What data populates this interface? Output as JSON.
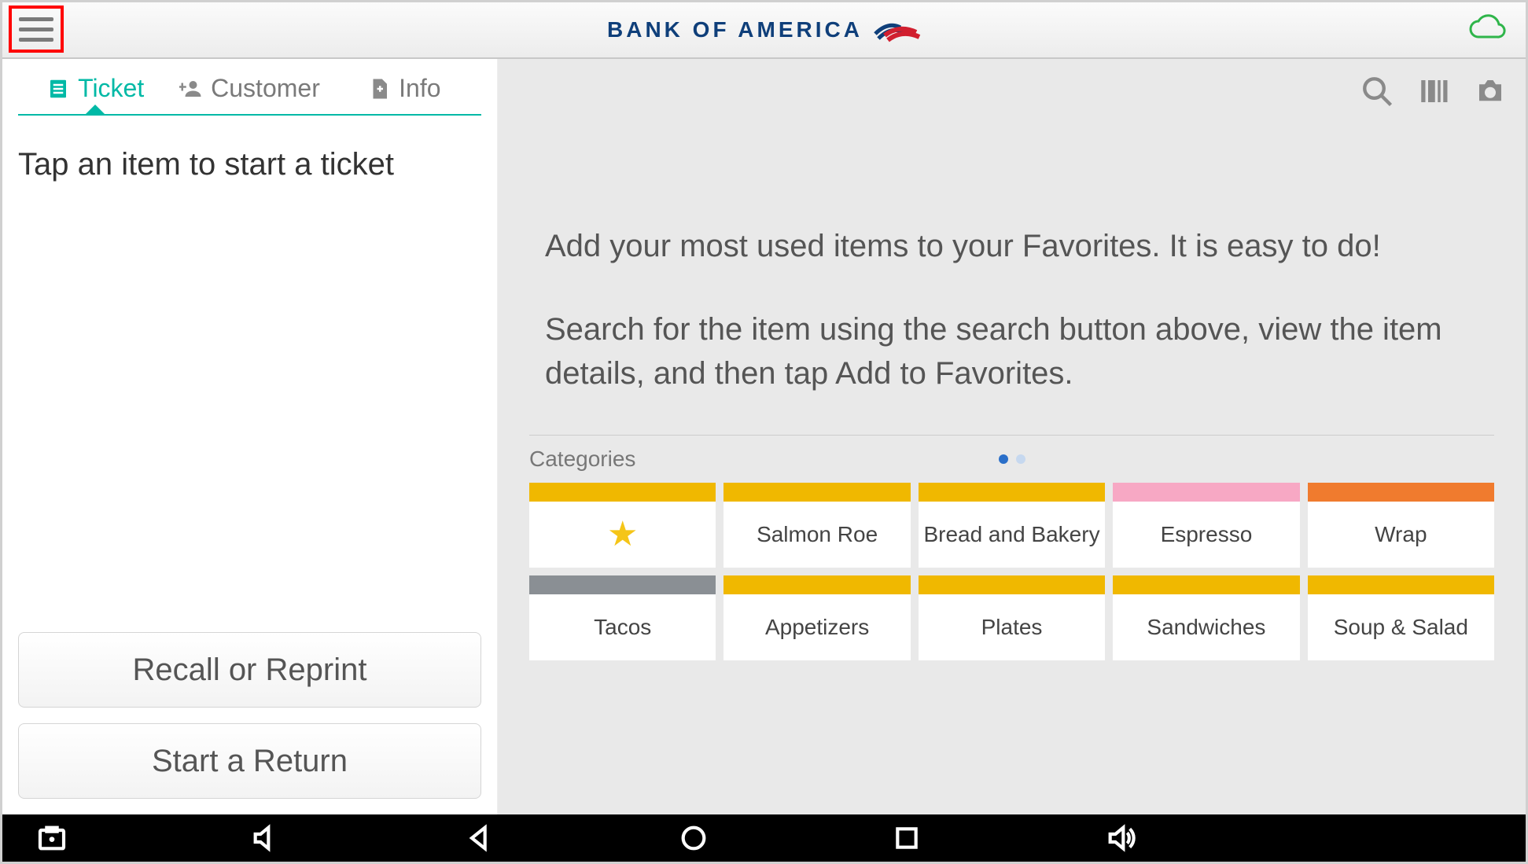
{
  "brand": {
    "name": "BANK OF AMERICA"
  },
  "sidebar": {
    "tabs": [
      {
        "label": "Ticket",
        "active": true
      },
      {
        "label": "Customer",
        "active": false
      },
      {
        "label": "Info",
        "active": false
      }
    ],
    "prompt": "Tap an item to start a ticket",
    "recall_button": "Recall or Reprint",
    "return_button": "Start a Return"
  },
  "main": {
    "help_para1": "Add your most used items to your Favorites. It is easy to do!",
    "help_para2": "Search for the item using the search button above, view the item details, and then tap Add to Favorites.",
    "categories_label": "Categories",
    "page_dots": {
      "count": 2,
      "active": 0
    },
    "categories_row1": [
      {
        "label": "",
        "stripe": "#f0b800",
        "star": true
      },
      {
        "label": "Salmon Roe",
        "stripe": "#f0b800"
      },
      {
        "label": "Bread and Bakery",
        "stripe": "#f0b800"
      },
      {
        "label": "Espresso",
        "stripe": "#f7a8c4"
      },
      {
        "label": "Wrap",
        "stripe": "#f07b2e"
      }
    ],
    "categories_row2": [
      {
        "label": "Tacos",
        "stripe": "#8a8f94"
      },
      {
        "label": "Appetizers",
        "stripe": "#f0b800"
      },
      {
        "label": "Plates",
        "stripe": "#f0b800"
      },
      {
        "label": "Sandwiches",
        "stripe": "#f0b800"
      },
      {
        "label": "Soup & Salad",
        "stripe": "#f0b800"
      }
    ]
  }
}
